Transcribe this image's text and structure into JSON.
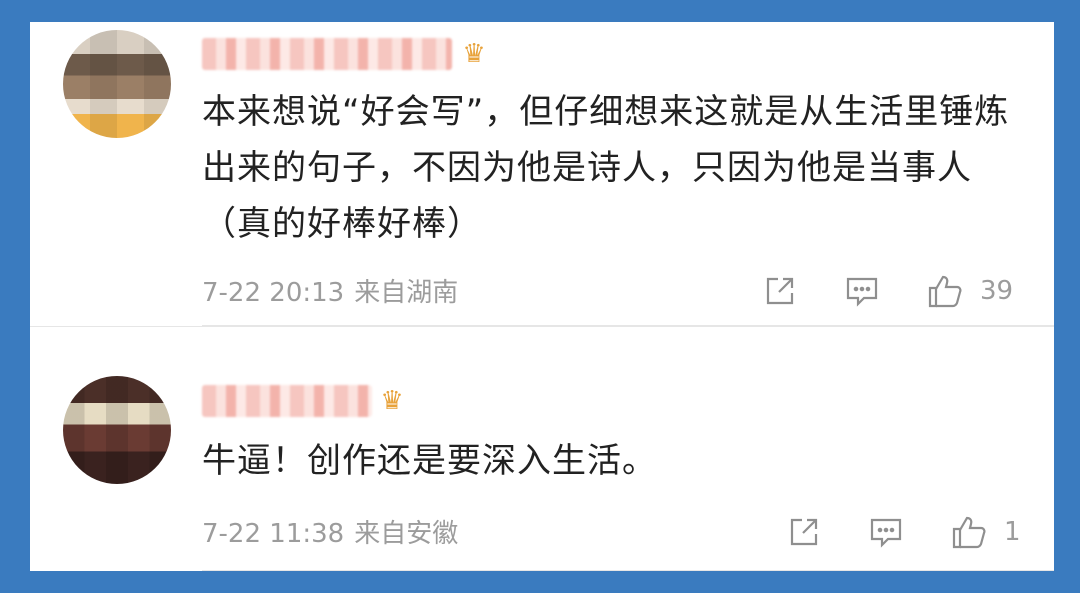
{
  "comments": [
    {
      "avatar": "avatar-image",
      "badge_icon": "crown-icon",
      "text": "本来想说“好会写”，但仔细想来这就是从生活里锤炼出来的句子，不因为他是诗人，只因为他是当事人（真的好棒好棒）",
      "time": "7-22 20:13",
      "source": "来自湖南",
      "likes": "39",
      "icons": {
        "share": "share-icon",
        "comment": "comment-icon",
        "like": "thumbs-up-icon"
      }
    },
    {
      "avatar": "avatar-image",
      "badge_icon": "crown-icon",
      "text": "牛逼！创作还是要深入生活。",
      "time": "7-22 11:38",
      "source": "来自安徽",
      "likes": "1",
      "icons": {
        "share": "share-icon",
        "comment": "comment-icon",
        "like": "thumbs-up-icon"
      }
    }
  ],
  "colors": {
    "background": "#3a7bbf",
    "card": "#ffffff",
    "text": "#222222",
    "meta": "#9c9c9c",
    "crown": "#e8a23a"
  }
}
